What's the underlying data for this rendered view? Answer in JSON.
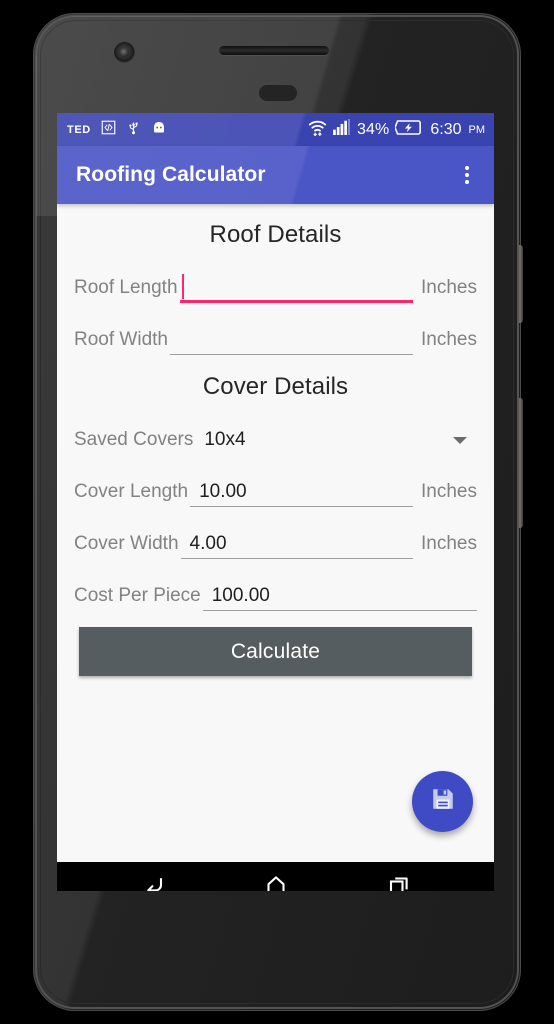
{
  "status_bar": {
    "left_label": "TED",
    "icons": [
      "code-brackets-icon",
      "usb-icon",
      "android-head-icon"
    ],
    "wifi_icon": "wifi-icon",
    "signal_icon": "signal-bars-icon",
    "battery_percent": "34%",
    "battery_icon": "battery-charging-icon",
    "time": "6:30",
    "ampm": "PM",
    "background": "#3a44b0"
  },
  "app_bar": {
    "title": "Roofing Calculator",
    "overflow_icon": "overflow-menu-icon",
    "background": "#4a55c6"
  },
  "sections": {
    "roof": {
      "title": "Roof Details",
      "fields": [
        {
          "label": "Roof Length",
          "value": "",
          "suffix": "Inches",
          "focused": true
        },
        {
          "label": "Roof Width",
          "value": "",
          "suffix": "Inches",
          "focused": false
        }
      ]
    },
    "cover": {
      "title": "Cover Details",
      "spinner": {
        "label": "Saved Covers",
        "value": "10x4",
        "arrow_icon": "chevron-down-icon"
      },
      "fields": [
        {
          "label": "Cover Length",
          "value": "10.00",
          "suffix": "Inches",
          "focused": false
        },
        {
          "label": "Cover Width",
          "value": "4.00",
          "suffix": "Inches",
          "focused": false
        },
        {
          "label": "Cost Per Piece",
          "value": "100.00",
          "suffix": "",
          "focused": false
        }
      ]
    }
  },
  "calculate_button": {
    "label": "Calculate",
    "background": "#565d61"
  },
  "fab": {
    "icon": "save-floppy-icon",
    "background": "#3f4bc4"
  },
  "nav_bar": {
    "back_icon": "back-arrow-icon",
    "home_icon": "home-icon",
    "recents_icon": "recent-apps-icon"
  },
  "accent_colors": {
    "focus_underline": "#f8276e",
    "content_background": "#f8f8f8",
    "label_text": "#828282"
  }
}
